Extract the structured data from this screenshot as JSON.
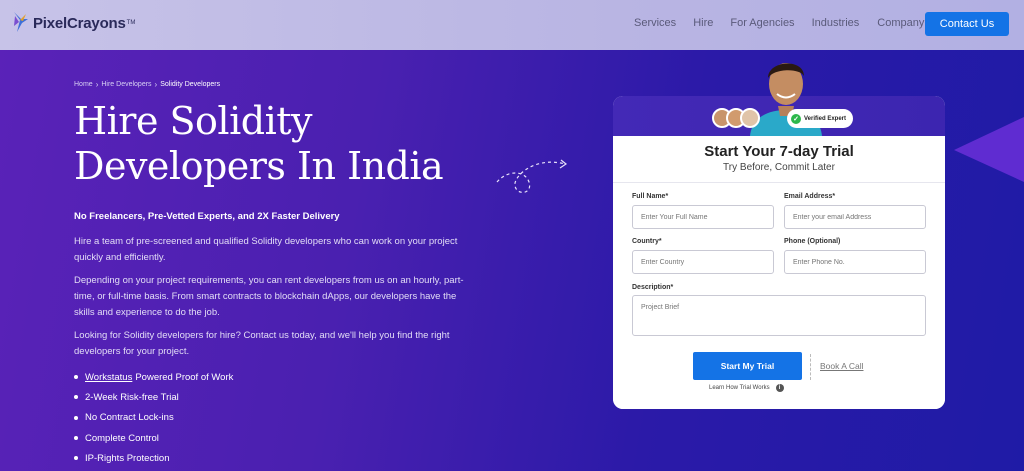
{
  "header": {
    "logo_text": "PixelCrayons",
    "logo_tm": "TM",
    "nav": [
      "Services",
      "Hire",
      "For Agencies",
      "Industries",
      "Company"
    ],
    "contact_label": "Contact Us"
  },
  "breadcrumb": {
    "items": [
      "Home",
      "Hire Developers",
      "Solidity Developers"
    ]
  },
  "hero": {
    "title_line1": "Hire Solidity",
    "title_line2": "Developers In India",
    "subhead": "No Freelancers, Pre-Vetted Experts, and 2X Faster Delivery",
    "paragraph1": "Hire a team of pre-screened and qualified Solidity developers who can work on your project quickly and efficiently.",
    "paragraph2": "Depending on your project requirements, you can rent developers from us on an hourly, part-time, or full-time basis. From smart contracts to blockchain dApps, our developers have the skills and experience to do the job.",
    "paragraph3": "Looking for Solidity developers for hire? Contact us today, and we'll help you find the right developers for your project.",
    "bullets": {
      "b1_link": "Workstatus",
      "b1_rest": "Powered Proof of Work",
      "b2": "2-Week Risk-free Trial",
      "b3": "No Contract Lock-ins",
      "b4": "Complete Control",
      "b5": "IP-Rights Protection"
    }
  },
  "form": {
    "verified_label": "Verified Expert",
    "title": "Start Your 7-day Trial",
    "subtitle": "Try Before, Commit Later",
    "full_name_label": "Full Name*",
    "full_name_placeholder": "Enter Your Full Name",
    "email_label": "Email Address*",
    "email_placeholder": "Enter your email Address",
    "country_label": "Country*",
    "country_placeholder": "Enter Country",
    "phone_label": "Phone (Optional)",
    "phone_placeholder": "Enter Phone No.",
    "description_label": "Description*",
    "description_placeholder": "Project Brief",
    "start_label": "Start My Trial",
    "book_label": "Book A Call",
    "learn_label": "Learn How Trial Works",
    "info_glyph": "i"
  },
  "colors": {
    "accent": "#1473e6",
    "verified": "#2db84b"
  }
}
